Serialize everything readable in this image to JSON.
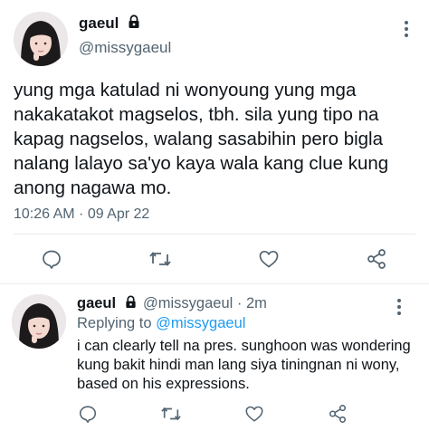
{
  "main_tweet": {
    "display_name": "gaeul",
    "handle": "@missygaeul",
    "text": "yung mga katulad ni wonyoung yung mga nakakatakot magselos, tbh. sila yung tipo na kapag nagselos, walang sasabihin pero bigla nalang lalayo sa'yo kaya wala kang clue kung anong nagawa mo.",
    "timestamp": "10:26 AM · 09 Apr 22"
  },
  "reply_tweet": {
    "display_name": "gaeul",
    "handle_time": "@missygaeul · 2m",
    "replying_prefix": "Replying to ",
    "replying_handle": "@missygaeul",
    "text": "i can clearly tell na pres. sunghoon was wondering kung bakit hindi man lang siya tiningnan ni wony, based on his expressions."
  },
  "icons": {
    "lock": "lock-icon",
    "more": "more-vertical-icon",
    "reply": "reply-icon",
    "retweet": "retweet-icon",
    "like": "heart-icon",
    "share": "share-icon"
  },
  "colors": {
    "text": "#0f1419",
    "secondary": "#536471",
    "link": "#1d9bf0",
    "divider": "#e6ecf0"
  }
}
